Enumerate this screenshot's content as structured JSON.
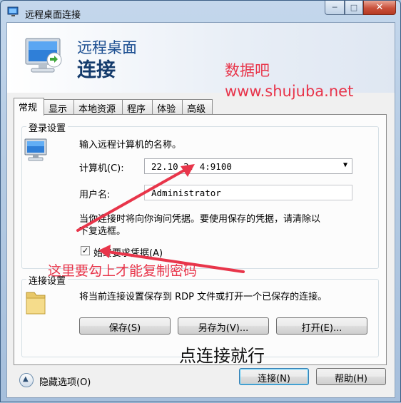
{
  "window": {
    "title": "远程桌面连接",
    "minimize_glyph": "─",
    "maximize_glyph": "□",
    "close_glyph": "✕"
  },
  "banner": {
    "subtitle": "远程桌面",
    "title": "连接"
  },
  "watermark": {
    "site_name": "数据吧",
    "site_url": "www.shujuba.net"
  },
  "tabs": [
    {
      "label": "常规",
      "active": true
    },
    {
      "label": "显示",
      "active": false
    },
    {
      "label": "本地资源",
      "active": false
    },
    {
      "label": "程序",
      "active": false
    },
    {
      "label": "体验",
      "active": false
    },
    {
      "label": "高级",
      "active": false
    }
  ],
  "login_group": {
    "title": "登录设置",
    "instruction": "输入远程计算机的名称。",
    "computer_label": "计算机(C):",
    "computer_value": "22.10  3. 4:9100",
    "username_label": "用户名:",
    "username_value": "Administrator",
    "notice_line1": "当你连接时将向你询问凭据。要使用保存的凭据，请清除以",
    "notice_line2": "下复选框。",
    "always_ask_label": "始终要求凭据(A)",
    "always_ask_checked": true,
    "check_glyph": "✓"
  },
  "connection_group": {
    "title": "连接设置",
    "description": "将当前连接设置保存到 RDP 文件或打开一个已保存的连接。",
    "save_label": "保存(S)",
    "save_as_label": "另存为(V)...",
    "open_label": "打开(E)..."
  },
  "bottom": {
    "hide_options_label": "隐藏选项(O)",
    "connect_label": "连接(N)",
    "help_label": "帮助(H)",
    "hide_glyph": "▲"
  },
  "annotations": {
    "check_hint": "这里要勾上才能复制密码",
    "connect_hint": "点连接就行"
  },
  "colors": {
    "annotation_red": "#e8354a",
    "brand_blue": "#1d4f91"
  }
}
